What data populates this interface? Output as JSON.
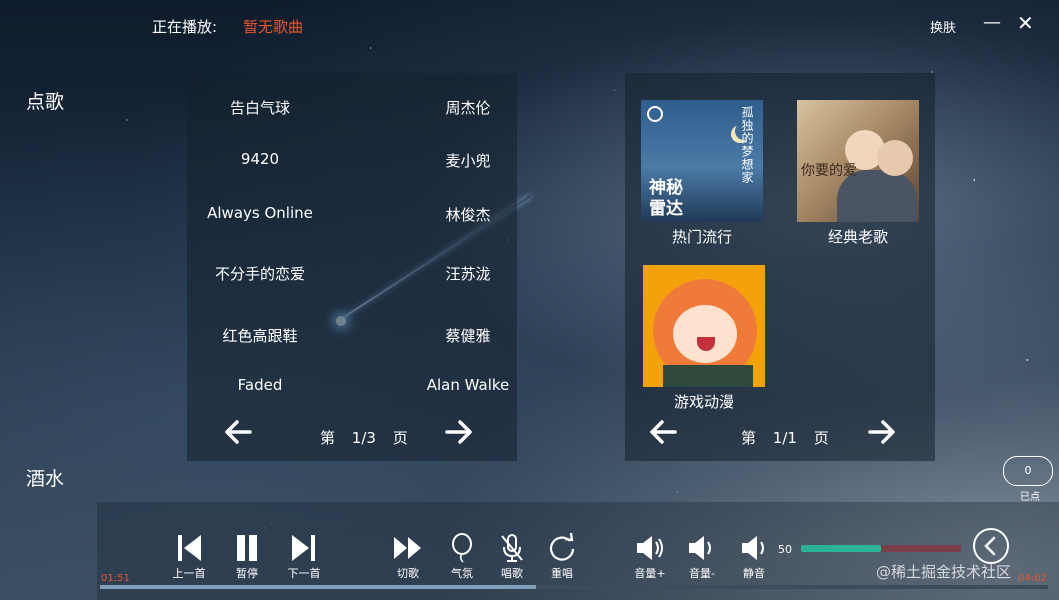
{
  "header": {
    "now_playing_label": "正在播放:",
    "now_playing_song": "暂无歌曲",
    "skin_label": "换肤",
    "minimize_glyph": "—",
    "close_glyph": "✕"
  },
  "sidebar": {
    "items": [
      {
        "label": "点歌"
      },
      {
        "label": "酒水"
      }
    ]
  },
  "song_list": {
    "songs": [
      {
        "title": "告白气球",
        "artist": "周杰伦"
      },
      {
        "title": "9420",
        "artist": "麦小兜"
      },
      {
        "title": "Always Online",
        "artist": "林俊杰"
      },
      {
        "title": "不分手的恋爱",
        "artist": "汪苏泷"
      },
      {
        "title": "红色高跟鞋",
        "artist": "蔡健雅"
      },
      {
        "title": "Faded",
        "artist": "Alan Walke"
      }
    ],
    "pager": {
      "prefix": "第",
      "current": "1/3",
      "suffix": "页"
    }
  },
  "categories": {
    "items": [
      {
        "label": "热门流行",
        "cover_title": "神秘\n雷达",
        "cover_subtitle": "孤独的梦想家"
      },
      {
        "label": "经典老歌",
        "cover_title": "你要的爱"
      },
      {
        "label": "游戏动漫"
      }
    ],
    "pager": {
      "prefix": "第",
      "current": "1/1",
      "suffix": "页"
    }
  },
  "player": {
    "controls": [
      {
        "label": "上一首",
        "icon": "skip-previous-icon"
      },
      {
        "label": "暂停",
        "icon": "pause-icon"
      },
      {
        "label": "下一首",
        "icon": "skip-next-icon"
      },
      {
        "label": "切歌",
        "icon": "fast-forward-icon"
      },
      {
        "label": "气氛",
        "icon": "balloon-icon"
      },
      {
        "label": "唱歌",
        "icon": "mic-off-icon"
      },
      {
        "label": "重唱",
        "icon": "replay-icon"
      },
      {
        "label": "音量+",
        "icon": "volume-up-icon"
      },
      {
        "label": "音量-",
        "icon": "volume-down-icon"
      },
      {
        "label": "静音",
        "icon": "mute-icon"
      }
    ],
    "volume_value": "50",
    "volume_fraction": 0.5,
    "time_elapsed": "01:51",
    "time_total": "04:02",
    "progress_fraction": 0.46,
    "served_count": "0",
    "served_label": "已点"
  },
  "watermark": "@稀土掘金技术社区",
  "colors": {
    "accent_orange": "#e8572a",
    "volume_fill": "#2db29a",
    "volume_track": "#7a3f48"
  }
}
